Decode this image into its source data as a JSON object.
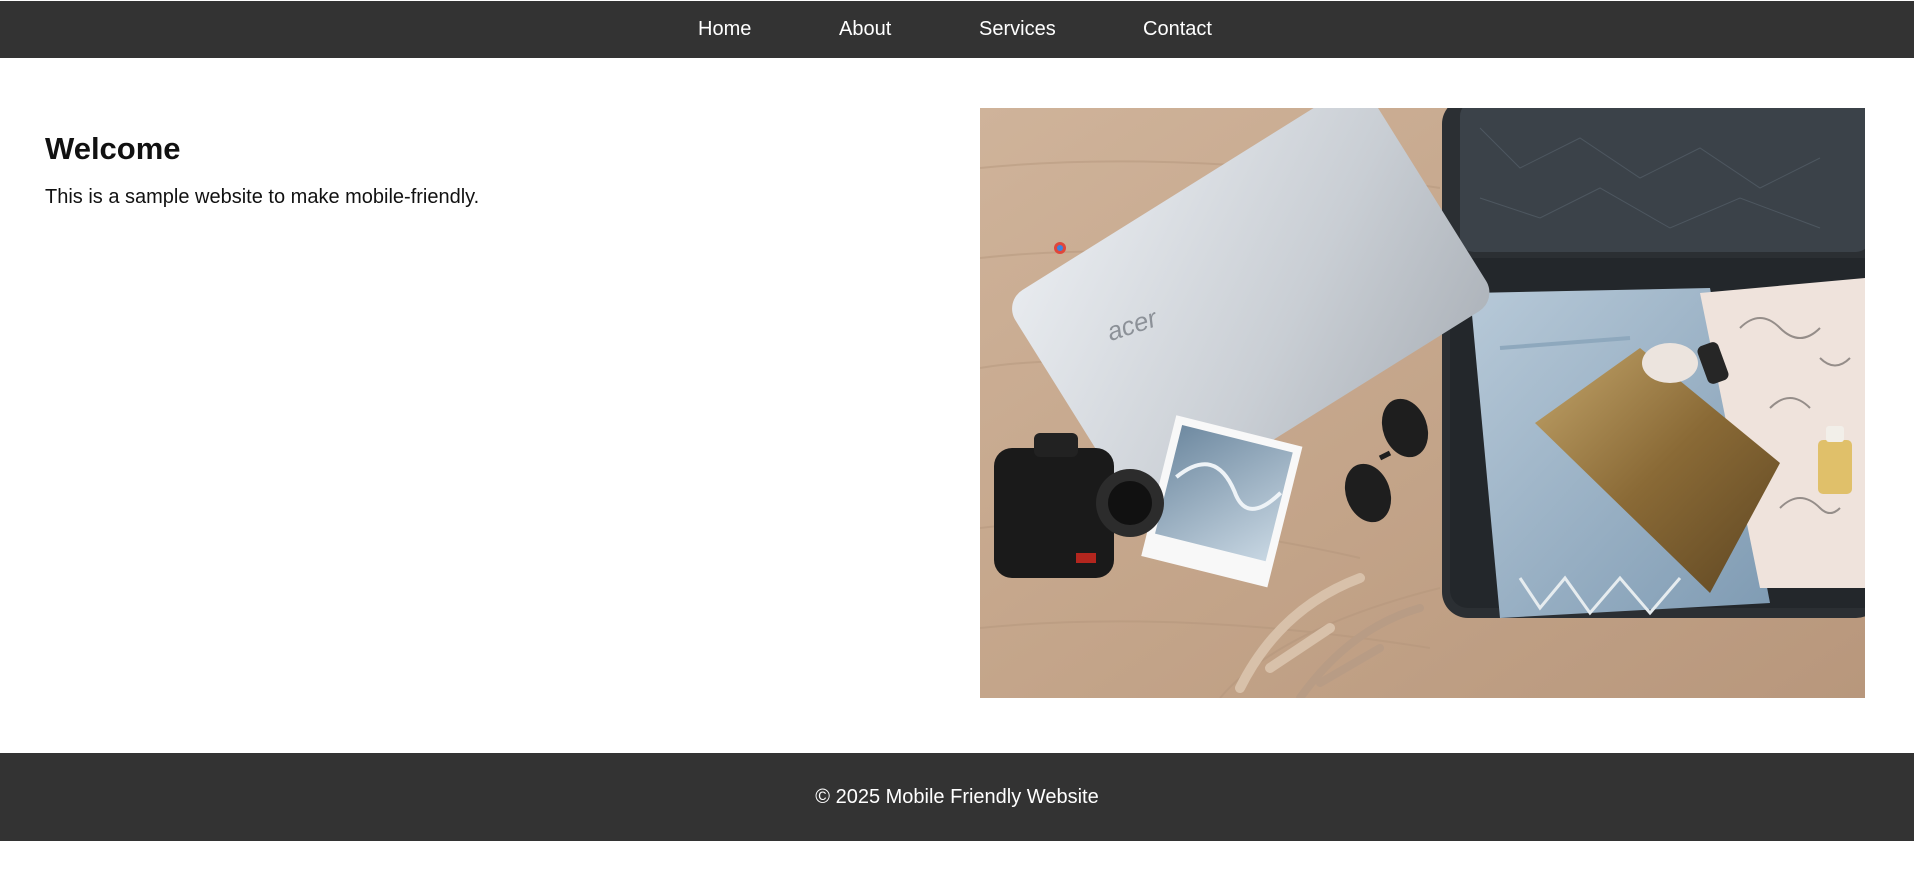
{
  "nav": {
    "items": [
      {
        "label": "Home"
      },
      {
        "label": "About"
      },
      {
        "label": "Services"
      },
      {
        "label": "Contact"
      }
    ]
  },
  "main": {
    "heading": "Welcome",
    "text": "This is a sample website to make mobile-friendly."
  },
  "hero_image": {
    "description_icon": "travel-flatlay-photo",
    "laptop_brand_text": "acer"
  },
  "footer": {
    "text": "© 2025 Mobile Friendly Website"
  },
  "colors": {
    "nav_bg": "#333333",
    "footer_bg": "#333333",
    "page_bg": "#ffffff",
    "nav_text": "#ffffff"
  }
}
